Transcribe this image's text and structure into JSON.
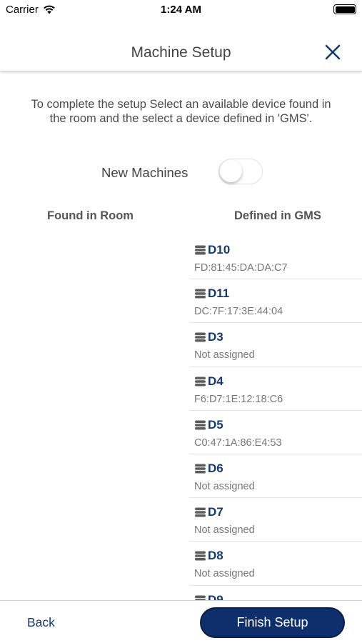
{
  "status_bar": {
    "carrier": "Carrier",
    "time": "1:24 AM",
    "wifi_icon": "wifi-icon",
    "battery_icon": "battery-icon"
  },
  "header": {
    "title": "Machine Setup",
    "close_icon": "close-icon"
  },
  "instructions": "To complete the setup Select an available device found in the room and the select a device defined in 'GMS'.",
  "toggle": {
    "label": "New Machines",
    "on": false
  },
  "columns": {
    "found": "Found in Room",
    "defined": "Defined in GMS"
  },
  "devices": [
    {
      "name": "D10",
      "detail": "FD:81:45:DA:DA:C7"
    },
    {
      "name": "D11",
      "detail": "DC:7F:17:3E:44:04"
    },
    {
      "name": "D3",
      "detail": "Not assigned"
    },
    {
      "name": "D4",
      "detail": "F6:D7:1E:12:18:C6"
    },
    {
      "name": "D5",
      "detail": "C0:47:1A:86:E4:53"
    },
    {
      "name": "D6",
      "detail": "Not assigned"
    },
    {
      "name": "D7",
      "detail": "Not assigned"
    },
    {
      "name": "D8",
      "detail": "Not assigned"
    },
    {
      "name": "D9",
      "detail": ""
    }
  ],
  "footer": {
    "back": "Back",
    "finish": "Finish Setup"
  },
  "colors": {
    "accent": "#173a6e",
    "button_bg": "#0e2f6b"
  }
}
